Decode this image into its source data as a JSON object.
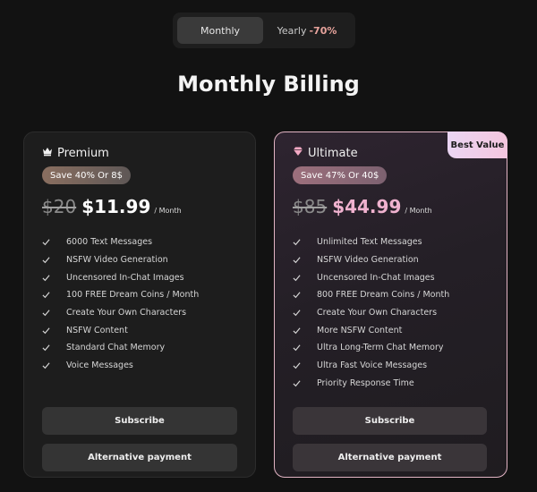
{
  "toggle": {
    "monthly_label": "Monthly",
    "yearly_label": "Yearly",
    "yearly_discount": "-70%"
  },
  "page_title": "Monthly Billing",
  "plans": [
    {
      "name": "Premium",
      "icon": "crown-icon",
      "save_badge": "Save 40% Or 8$",
      "old_price": "$20",
      "new_price": "$11.99",
      "per": "/ Month",
      "features": [
        "6000 Text Messages",
        "NSFW Video Generation",
        "Uncensored In-Chat Images",
        "100 FREE Dream Coins / Month",
        "Create Your Own Characters",
        "NSFW Content",
        "Standard Chat Memory",
        "Voice Messages"
      ],
      "subscribe_label": "Subscribe",
      "alt_payment_label": "Alternative payment"
    },
    {
      "name": "Ultimate",
      "icon": "diamond-icon",
      "badge": "Best Value",
      "save_badge": "Save 47% Or 40$",
      "old_price": "$85",
      "new_price": "$44.99",
      "per": "/ Month",
      "features": [
        "Unlimited Text Messages",
        "NSFW Video Generation",
        "Uncensored In-Chat Images",
        "800 FREE Dream Coins / Month",
        "Create Your Own Characters",
        "More NSFW Content",
        "Ultra Long-Term Chat Memory",
        "Ultra Fast Voice Messages",
        "Priority Response Time"
      ],
      "subscribe_label": "Subscribe",
      "alt_payment_label": "Alternative payment"
    }
  ],
  "colors": {
    "background": "#121212",
    "discount": "#e7a39c",
    "ultimate_accent": "#f0b2cf",
    "ultimate_border": "#e2b4c4"
  }
}
